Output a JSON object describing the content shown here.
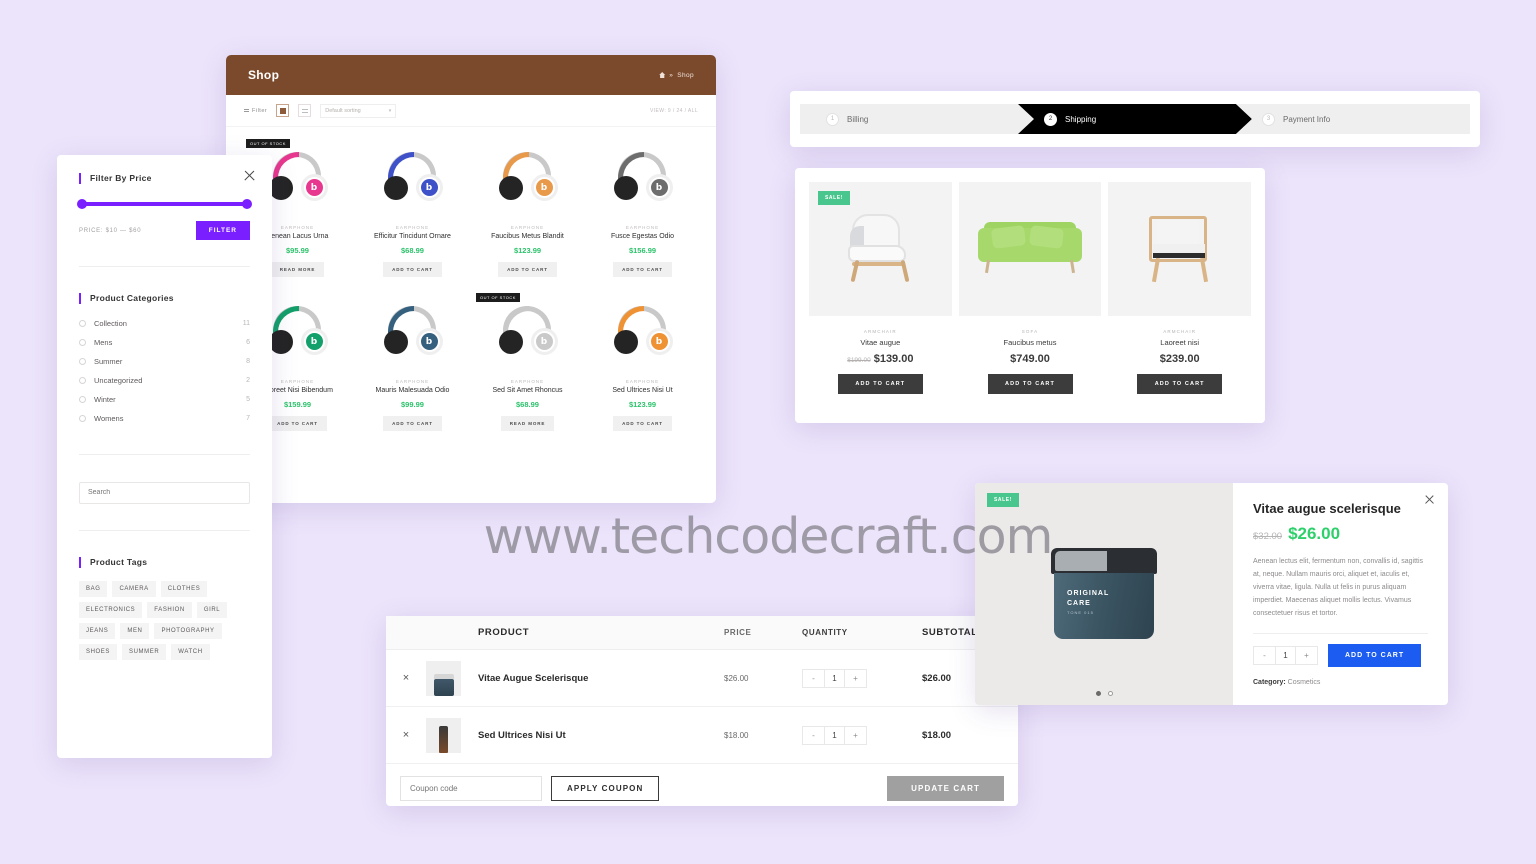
{
  "watermark": "www.techcodecraft.com",
  "shop": {
    "header": {
      "title": "Shop",
      "breadcrumb_home": "",
      "breadcrumb_sep": "»",
      "breadcrumb_current": "Shop"
    },
    "toolbar": {
      "filter_label": "Filter",
      "grid_icon": "grid-view-icon",
      "list_icon": "list-view-icon",
      "sorting_value": "Default sorting",
      "sorting_caret": "▾",
      "view_label": "VIEW: 9 / 24 / ALL"
    },
    "badges": {
      "out_of_stock": "OUT OF STOCK"
    },
    "products": [
      {
        "category": "EARPHONE",
        "name": "Aenean Lacus Urna",
        "price": "$95.99",
        "button": "READ MORE",
        "out_of_stock": true,
        "color": "#e8378f",
        "letter": "b"
      },
      {
        "category": "EARPHONE",
        "name": "Efficitur Tincidunt Ornare",
        "price": "$68.99",
        "button": "ADD TO CART",
        "out_of_stock": false,
        "color": "#3f51c9",
        "letter": "b"
      },
      {
        "category": "EARPHONE",
        "name": "Faucibus Metus Blandit",
        "price": "$123.99",
        "button": "ADD TO CART",
        "out_of_stock": false,
        "color": "#e8994a",
        "letter": "b"
      },
      {
        "category": "EARPHONE",
        "name": "Fusce Egestas Odio",
        "price": "$156.99",
        "button": "ADD TO CART",
        "out_of_stock": false,
        "color": "#6d6d6d",
        "letter": "b"
      },
      {
        "category": "EARPHONE",
        "name": "Laoreet Nisi Bibendum",
        "price": "$159.99",
        "button": "ADD TO CART",
        "out_of_stock": false,
        "color": "#13a06a",
        "letter": "b"
      },
      {
        "category": "EARPHONE",
        "name": "Mauris Malesuada Odio",
        "price": "$99.99",
        "button": "ADD TO CART",
        "out_of_stock": false,
        "color": "#35617f",
        "letter": "b"
      },
      {
        "category": "EARPHONE",
        "name": "Sed Sit Amet Rhoncus",
        "price": "$68.99",
        "button": "READ MORE",
        "out_of_stock": true,
        "color": "#c9c9c9",
        "letter": "b"
      },
      {
        "category": "EARPHONE",
        "name": "Sed Ultrices Nisi Ut",
        "price": "$123.99",
        "button": "ADD TO CART",
        "out_of_stock": false,
        "color": "#ef9234",
        "letter": "b"
      }
    ]
  },
  "filter_sidebar": {
    "price_title": "Filter By Price",
    "price_text": "PRICE: $10 — $60",
    "filter_button": "FILTER",
    "categories_title": "Product Categories",
    "categories": [
      {
        "label": "Collection",
        "count": "11"
      },
      {
        "label": "Mens",
        "count": "6"
      },
      {
        "label": "Summer",
        "count": "8"
      },
      {
        "label": "Uncategorized",
        "count": "2"
      },
      {
        "label": "Winter",
        "count": "5"
      },
      {
        "label": "Womens",
        "count": "7"
      }
    ],
    "search_placeholder": "Search",
    "tags_title": "Product Tags",
    "tags": [
      "BAG",
      "CAMERA",
      "CLOTHES",
      "ELECTRONICS",
      "FASHION",
      "GIRL",
      "JEANS",
      "MEN",
      "PHOTOGRAPHY",
      "SHOES",
      "SUMMER",
      "WATCH"
    ]
  },
  "checkout_steps": [
    {
      "num": "1",
      "label": "Billing",
      "active": false
    },
    {
      "num": "2",
      "label": "Shipping",
      "active": true
    },
    {
      "num": "3",
      "label": "Payment Info",
      "active": false
    }
  ],
  "furniture": {
    "sale_badge": "SALE!",
    "items": [
      {
        "category": "ARMCHAIR",
        "name": "Vitae augue",
        "old_price": "$199.00",
        "price": "$139.00",
        "button": "ADD TO CART",
        "on_sale": true
      },
      {
        "category": "SOFA",
        "name": "Faucibus metus",
        "old_price": "",
        "price": "$749.00",
        "button": "ADD TO CART",
        "on_sale": false
      },
      {
        "category": "ARMCHAIR",
        "name": "Laoreet nisi",
        "old_price": "",
        "price": "$239.00",
        "button": "ADD TO CART",
        "on_sale": false
      }
    ]
  },
  "cart": {
    "columns": {
      "remove": "",
      "image": "",
      "product": "PRODUCT",
      "price": "PRICE",
      "quantity": "QUANTITY",
      "subtotal": "SUBTOTAL"
    },
    "rows": [
      {
        "remove": "×",
        "name": "Vitae Augue Scelerisque",
        "price": "$26.00",
        "qty_minus": "-",
        "qty": "1",
        "qty_plus": "+",
        "subtotal": "$26.00"
      },
      {
        "remove": "×",
        "name": "Sed Ultrices Nisi Ut",
        "price": "$18.00",
        "qty_minus": "-",
        "qty": "1",
        "qty_plus": "+",
        "subtotal": "$18.00"
      }
    ],
    "coupon_placeholder": "Coupon code",
    "apply_button": "APPLY COUPON",
    "update_button": "UPDATE CART"
  },
  "quickview": {
    "sale_badge": "SALE!",
    "title": "Vitae augue scelerisque",
    "old_price": "$32.00",
    "price": "$26.00",
    "description": "Aenean lectus elit, fermentum non, convallis id, sagittis at, neque. Nullam mauris orci, aliquet et, iaculis et, viverra vitae, ligula. Nulla ut felis in purus aliquam imperdiet. Maecenas aliquet mollis lectus. Vivamus consectetuer risus et tortor.",
    "qty_minus": "-",
    "qty": "1",
    "qty_plus": "+",
    "add_to_cart": "ADD TO CART",
    "category_label": "Category:",
    "category_value": "Cosmetics",
    "product_label_1": "ORIGINAL",
    "product_label_2": "CARE",
    "product_label_3": "TONE 015"
  }
}
